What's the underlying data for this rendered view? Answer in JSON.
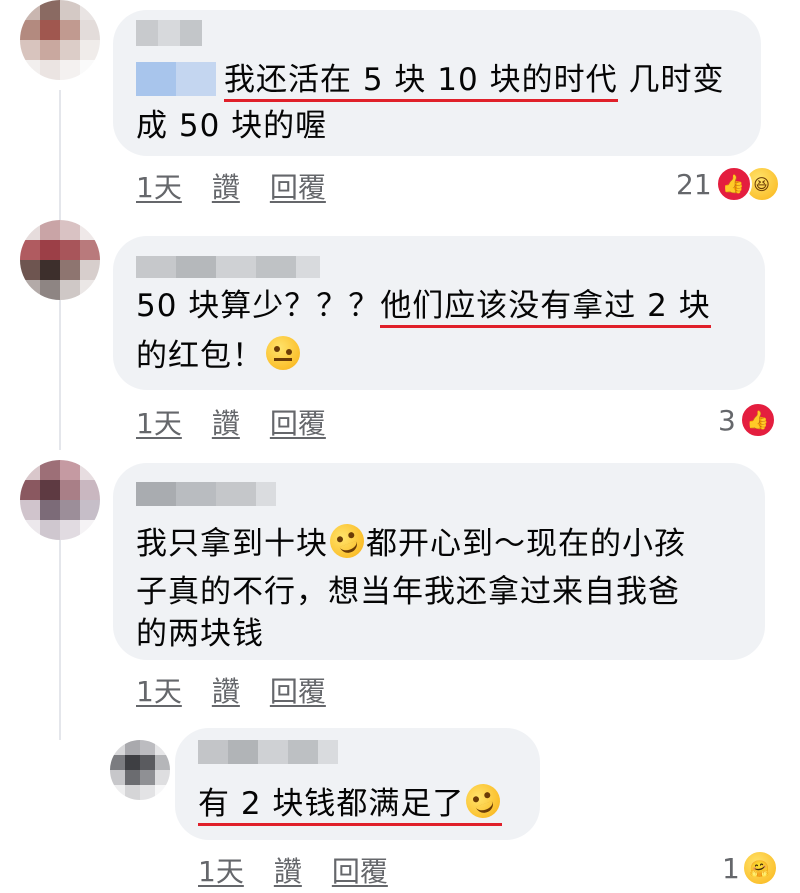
{
  "comments": [
    {
      "text_line1_pre": "",
      "text_line1_ul": "我还活在 5 块 10 块的时代",
      "text_line1_post": " 几时变",
      "text_line2": "成 50 块的喔",
      "time": "1天",
      "like": "讚",
      "reply": "回覆",
      "reaction_count": "21",
      "reactions": [
        "like-icon",
        "haha-icon"
      ]
    },
    {
      "text_line1_pre": "50 块算少？？？",
      "text_line1_ul": "他们应该没有拿过 2 块",
      "text_line2": "的红包！",
      "emoji": "raised-eyebrow-emoji",
      "time": "1天",
      "like": "讚",
      "reply": "回覆",
      "reaction_count": "3",
      "reactions": [
        "like-icon"
      ]
    },
    {
      "text_line1a": "我只拿到十块",
      "emoji": "rofl-emoji",
      "text_line1b": "都开心到～现在的小孩",
      "text_line2": "子真的不行，想当年我还拿过来自我爸",
      "text_line3": "的两块钱",
      "time": "1天",
      "like": "讚",
      "reply": "回覆"
    },
    {
      "text_line1_ul": "有 2 块钱都满足了",
      "emoji": "rofl-emoji",
      "time": "1天",
      "like": "讚",
      "reply": "回覆",
      "reaction_count": "1",
      "reactions": [
        "care-icon"
      ]
    }
  ],
  "colors": {
    "bubble": "#f0f2f5",
    "underline": "#e0202a",
    "meta_text": "#65676b",
    "like_red": "#e41e3f"
  }
}
